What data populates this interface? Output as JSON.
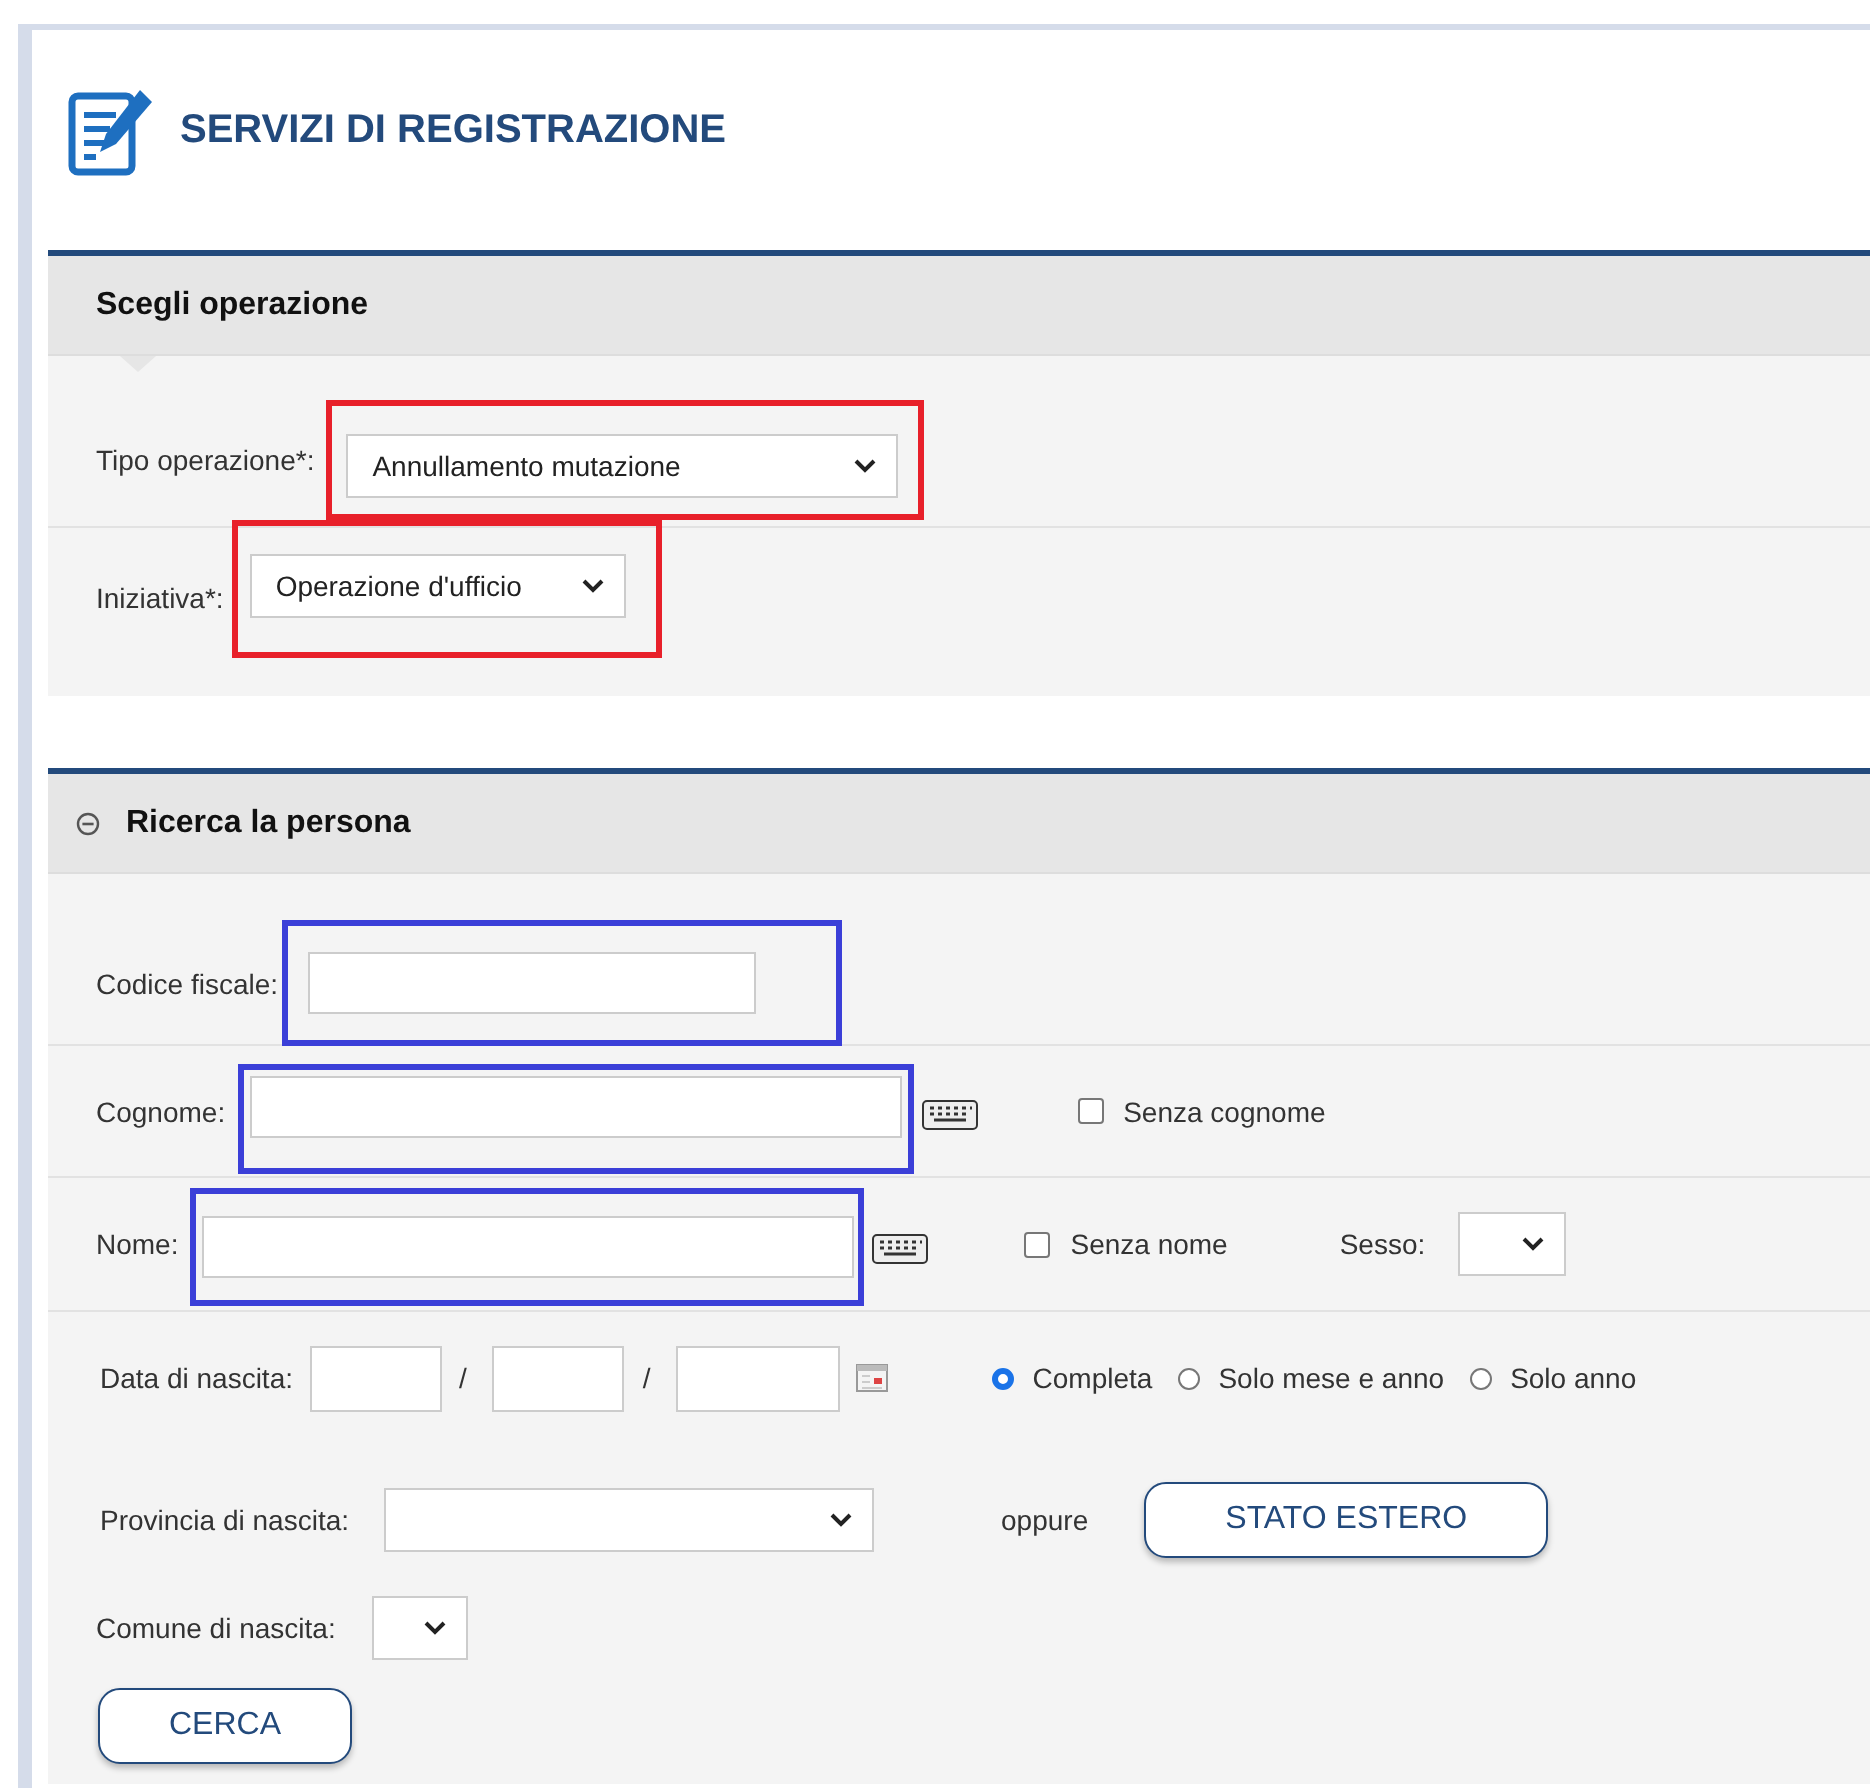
{
  "header": {
    "title": "SERVIZI DI REGISTRAZIONE"
  },
  "operation_section": {
    "title": "Scegli operazione",
    "fields": [
      {
        "label": "Tipo operazione*:",
        "value": "Annullamento mutazione",
        "color": "#e8202a"
      },
      {
        "label": "Iniziativa*:",
        "value": "Operazione d'ufficio",
        "color": "#e8202a"
      }
    ]
  },
  "search_section": {
    "title": "Ricerca la persona",
    "expanded": true,
    "codice_fiscale": {
      "label": "Codice fiscale:",
      "color": "#3b3fd8"
    },
    "cognome": {
      "label": "Cognome:",
      "color": "#3b3fd8",
      "checkbox": {
        "label": "Senza cognome",
        "checked": false
      }
    },
    "nome": {
      "label": "Nome:",
      "color": "#3b3fd8",
      "checkbox": {
        "label": "Senza nome",
        "checked": false
      },
      "sex_label": "Sesso:"
    },
    "birth_date": {
      "label": "Data di nascita:",
      "separators": [
        "/",
        "/"
      ],
      "modes": [
        {
          "label": "Completa",
          "selected": true
        },
        {
          "label": "Solo mese e anno",
          "selected": false
        },
        {
          "label": "Solo anno",
          "selected": false
        }
      ]
    },
    "province": {
      "label": "Provincia di nascita:",
      "or_text": "oppure",
      "foreign_button": "STATO ESTERO"
    },
    "comune": {
      "label": "Comune di nascita:"
    },
    "search_button": "CERCA"
  }
}
